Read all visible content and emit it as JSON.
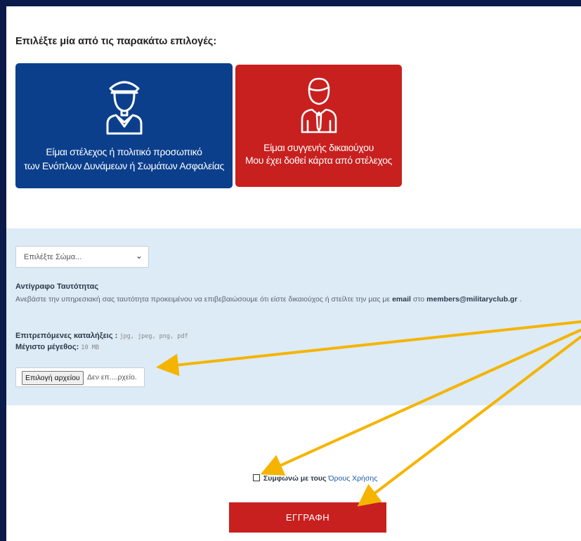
{
  "prompt": "Επιλέξτε μία από τις παρακάτω επιλογές:",
  "cards": [
    {
      "line1": "Είμαι στέλεχος ή πολιτικό προσωπικό",
      "line2": "των Ενόπλων Δυνάμεων ή Σωμάτων Ασφαλείας",
      "color": "#0b3f8c",
      "icon": "officer-icon"
    },
    {
      "line1": "Είμαι συγγενής δικαιούχου",
      "line2": "Μου έχει δοθεί κάρτα από στέλεχος",
      "color": "#c8201f",
      "icon": "person-tie-icon"
    }
  ],
  "form": {
    "corps_select": "Επιλέξτε Σώμα...",
    "id_title": "Αντίγραφο Ταυτότητας",
    "id_desc_pre": "Ανεβάστε την υπηρεσιακή σας ταυτότητα προκειμένου να επιβεβαιώσουμε ότι είστε δικαιούχος ή στείλτε την μας με",
    "id_desc_email_label": "email",
    "id_desc_mid": "στο",
    "id_desc_email": "members@militaryclub.gr",
    "id_desc_end": ".",
    "ext_label": "Επιτρεπόμενες καταλήξεις :",
    "ext_values": "jpg, jpeg, png, pdf",
    "size_label": "Μέγιστο μέγεθος:",
    "size_value": "10 MB",
    "choose_button": "Επιλογή αρχείου",
    "file_status": "Δεν επ....ρχείο."
  },
  "terms": {
    "agree": "Συμφωνώ με τους",
    "link": "Όρους Χρήσης"
  },
  "submit": "ΕΓΓΡΑΦΗ",
  "annotation_color": "#f5b400"
}
